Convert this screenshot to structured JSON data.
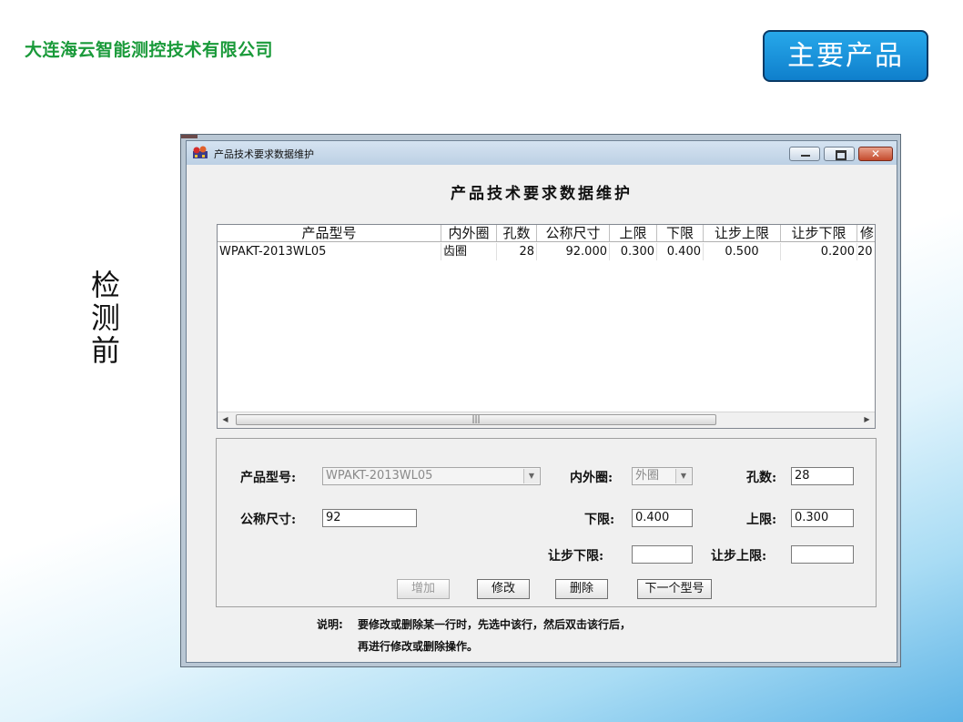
{
  "slide": {
    "company": "大连海云智能测控技术有限公司",
    "main_button": "主要产品",
    "vertical_label": "检测前"
  },
  "window": {
    "title": "产品技术要求数据维护",
    "heading": "产品技术要求数据维护",
    "close_glyph": "✕"
  },
  "grid": {
    "columns": [
      "产品型号",
      "内外圈",
      "孔数",
      "公称尺寸",
      "上限",
      "下限",
      "让步上限",
      "让步下限",
      "修"
    ],
    "rows": [
      [
        "WPAKT-2013WL05",
        "齿圈",
        "28",
        "92.000",
        "0.300",
        "0.400",
        "0.500",
        "0.200",
        "20"
      ]
    ],
    "scroll_left": "◀",
    "scroll_right": "▶",
    "thumb_grip": "|||"
  },
  "form": {
    "model_label": "产品型号:",
    "model_value": "WPAKT-2013WL05",
    "ring_label": "内外圈:",
    "ring_value": "外圈",
    "holes_label": "孔数:",
    "holes_value": "28",
    "nominal_label": "公称尺寸:",
    "nominal_value": "92",
    "lower_label": "下限:",
    "lower_value": "0.400",
    "upper_label": "上限:",
    "upper_value": "0.300",
    "conc_lower_label": "让步下限:",
    "conc_lower_value": "",
    "conc_upper_label": "让步上限:",
    "conc_upper_value": "",
    "combo_arrow": "▼"
  },
  "buttons": {
    "add": "增加",
    "modify": "修改",
    "delete": "删除",
    "next_model": "下一个型号"
  },
  "note": {
    "prefix": "说明:",
    "line1": "要修改或删除某一行时，先选中该行，然后双击该行后，",
    "line2": "再进行修改或删除操作。"
  },
  "colors": {
    "company": "#1a9a3a",
    "main_button_bg": "#1a93dc",
    "titlebar": "#c8d9ea",
    "close_button": "#c44a2c"
  }
}
